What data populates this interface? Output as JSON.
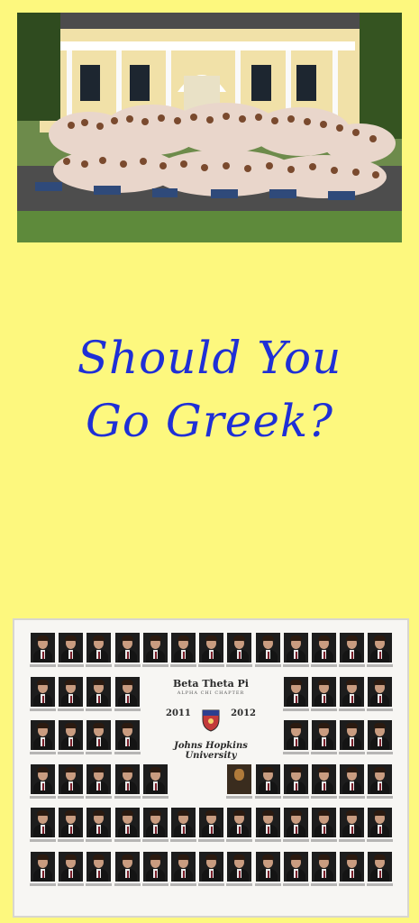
{
  "headline": {
    "line1": "Should You",
    "line2": "Go Greek?"
  },
  "composite": {
    "title": "Beta Theta Pi",
    "subtitle": "ALPHA CHI CHAPTER",
    "year_start": "2011",
    "year_end": "2012",
    "school_line1": "Johns Hopkins",
    "school_line2": "University"
  },
  "colors": {
    "background": "#fdf87e",
    "headline": "#1f2fd6"
  }
}
